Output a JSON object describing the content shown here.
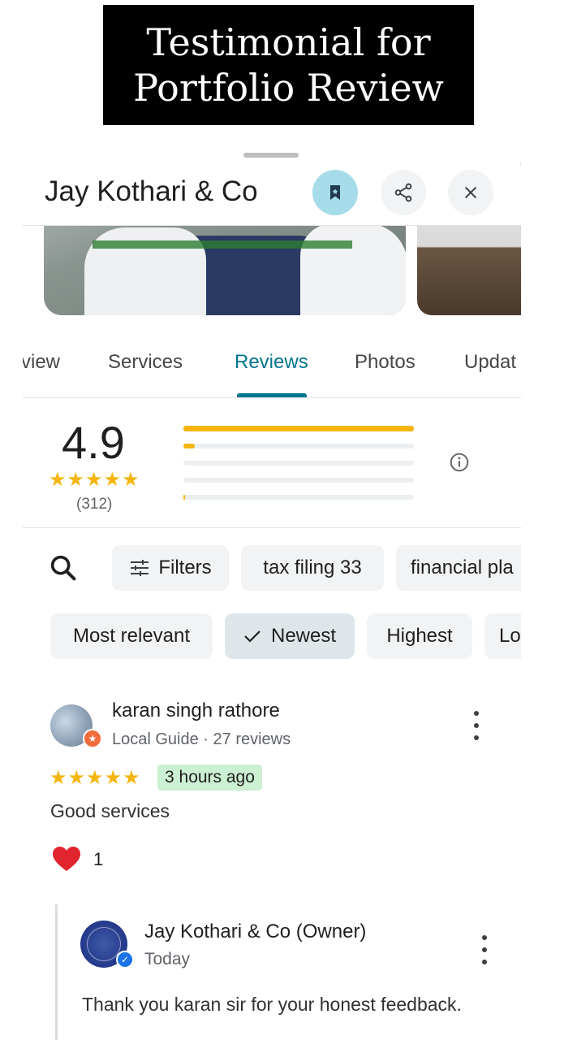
{
  "banner": {
    "line1": "Testimonial for",
    "line2": "Portfolio Review"
  },
  "header": {
    "place_name": "Jay Kothari & Co",
    "save_icon": "bookmark-icon",
    "share_icon": "share-icon",
    "close_icon": "close-icon",
    "save_color": "#a6dcea"
  },
  "tabs": [
    {
      "label": "view"
    },
    {
      "label": "Services"
    },
    {
      "label": "Reviews",
      "active": true
    },
    {
      "label": "Photos"
    },
    {
      "label": "Updat"
    }
  ],
  "rating": {
    "value": "4.9",
    "stars": "★★★★★",
    "count": "(312)",
    "distribution": [
      {
        "stars": 5,
        "fraction": 1.0
      },
      {
        "stars": 4,
        "fraction": 0.05
      },
      {
        "stars": 3,
        "fraction": 0.0
      },
      {
        "stars": 2,
        "fraction": 0.0
      },
      {
        "stars": 1,
        "fraction": 0.005
      }
    ]
  },
  "filters": {
    "search_icon": "search-icon",
    "chips": [
      {
        "label": "Filters",
        "icon": "sliders-icon"
      },
      {
        "label": "tax filing 33"
      },
      {
        "label": "financial pla"
      }
    ]
  },
  "sort": {
    "chips": [
      {
        "label": "Most relevant"
      },
      {
        "label": "Newest",
        "selected": true
      },
      {
        "label": "Highest"
      },
      {
        "label": "Lo"
      }
    ]
  },
  "review": {
    "author": "karan singh rathore",
    "meta": "Local Guide · 27 reviews",
    "stars": "★★★★★",
    "time": "3 hours ago",
    "text": "Good services",
    "likes": "1"
  },
  "owner_reply": {
    "name": "Jay Kothari & Co (Owner)",
    "time": "Today",
    "text": "Thank you karan sir for your honest feedback."
  },
  "colors": {
    "accent": "#00758f",
    "star": "#f5b50c",
    "time_badge": "#ccf0d2"
  }
}
